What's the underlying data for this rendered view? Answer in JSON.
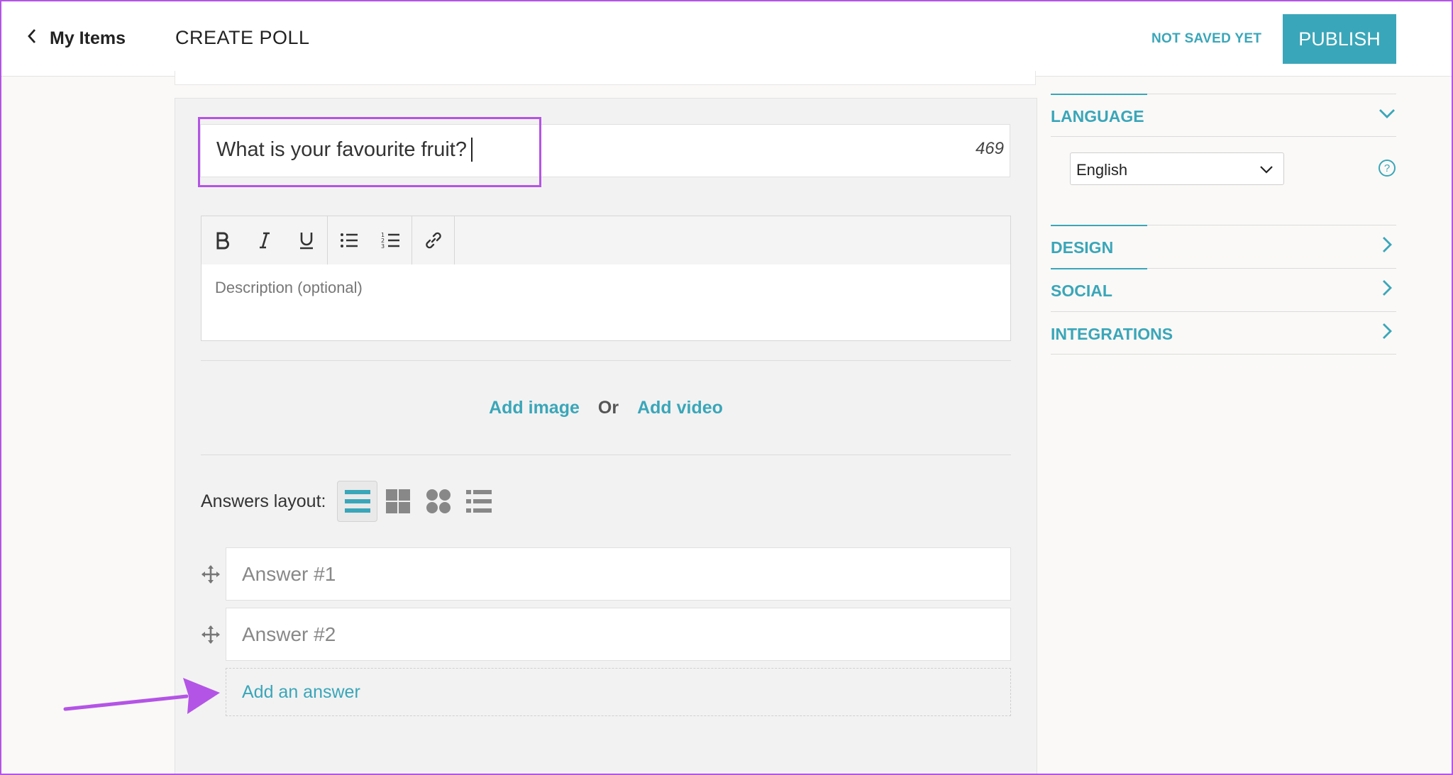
{
  "header": {
    "back_label": "My Items",
    "title": "CREATE POLL",
    "save_status": "NOT SAVED YET",
    "publish_label": "PUBLISH"
  },
  "question": {
    "text": "What is your favourite fruit?",
    "char_count": "469"
  },
  "editor": {
    "description_placeholder": "Description (optional)",
    "toolbar_icons": [
      "bold-icon",
      "italic-icon",
      "underline-icon",
      "bulleted-list-icon",
      "numbered-list-icon",
      "link-icon"
    ]
  },
  "media": {
    "add_image": "Add image",
    "or": "Or",
    "add_video": "Add video"
  },
  "answers_layout": {
    "label": "Answers layout:",
    "options": [
      "list-layout-icon",
      "grid-layout-icon",
      "circles-layout-icon",
      "bullet-list-layout-icon"
    ],
    "selected": "list-layout-icon"
  },
  "answers": {
    "items": [
      {
        "placeholder": "Answer #1"
      },
      {
        "placeholder": "Answer #2"
      }
    ],
    "add_label": "Add an answer"
  },
  "settings": {
    "language": {
      "label": "LANGUAGE",
      "selected": "English",
      "help": "?"
    },
    "design": {
      "label": "DESIGN"
    },
    "social": {
      "label": "SOCIAL"
    },
    "integrations": {
      "label": "INTEGRATIONS"
    }
  },
  "colors": {
    "accent": "#3aa6b9",
    "highlight": "#b454e6"
  }
}
